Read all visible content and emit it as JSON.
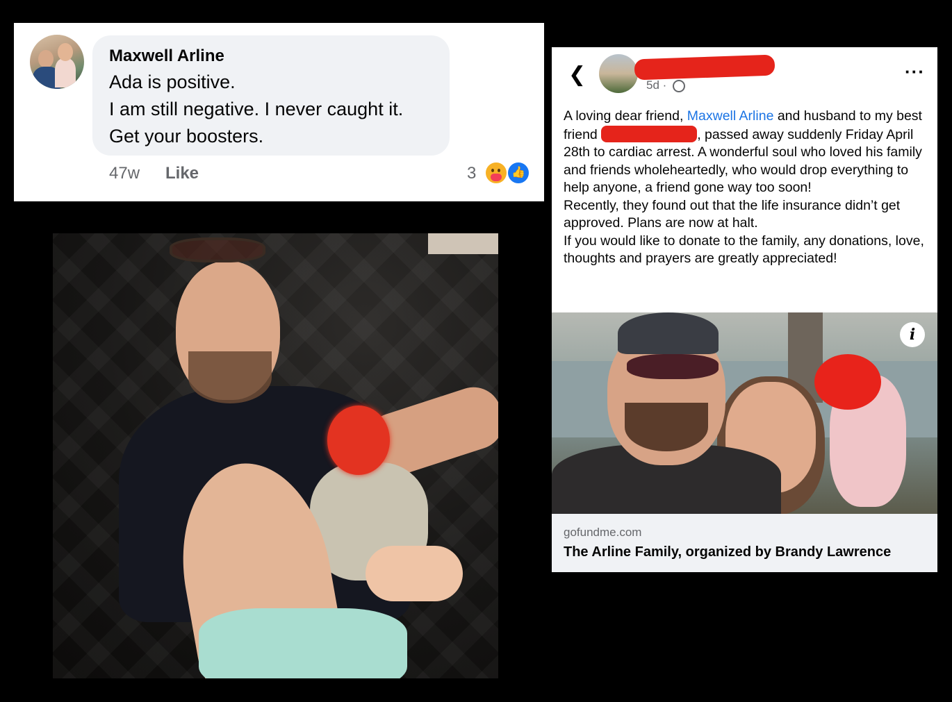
{
  "comment": {
    "author": "Maxwell Arline",
    "lines": [
      "Ada is positive.",
      "I am still negative. I never caught it.",
      "Get your boosters."
    ],
    "age": "47w",
    "like_label": "Like",
    "reaction_count": "3",
    "reactions": [
      "care-icon",
      "like-icon"
    ]
  },
  "post": {
    "time": "5d",
    "separator": "·",
    "text_before_mention": "A loving dear friend, ",
    "mention": "Maxwell Arline",
    "text_after_mention": " and husband to my best friend ",
    "text_after_redaction": ", passed away suddenly Friday April 28th to cardiac arrest. A wonderful soul who loved his family and friends wholeheartedly, who would drop everything to help anyone, a friend gone way too soon!",
    "paragraph2": "Recently, they found out that the life insurance didn’t get approved. Plans are now at halt.",
    "paragraph3": "If you would like to donate to the family, any donations, love, thoughts and prayers are greatly appreciated!",
    "link_domain": "gofundme.com",
    "link_title": "The Arline Family, organized by Brandy Lawrence"
  },
  "colors": {
    "mention": "#1b74e4",
    "redaction": "#e5241b",
    "like_blue": "#1877f2",
    "bubble": "#f0f2f5"
  }
}
